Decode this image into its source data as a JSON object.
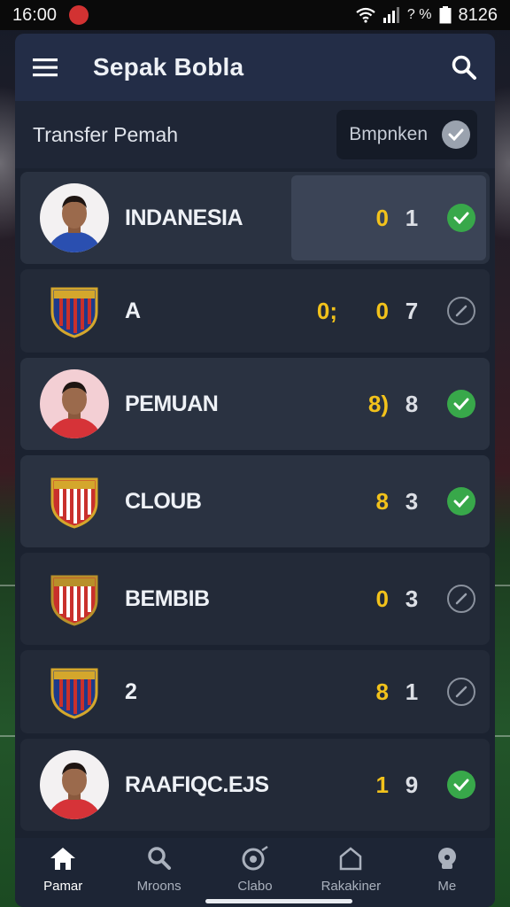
{
  "status_bar": {
    "time": "16:00",
    "battery_text": "? %",
    "right_text": "8126"
  },
  "header": {
    "title": "Sepak Bobla",
    "menu_icon": "menu-icon",
    "search_icon": "search-icon"
  },
  "filter": {
    "label": "Transfer Pemah",
    "chip_label": "Bmpnken",
    "checked": true
  },
  "rows": [
    {
      "name": "INDANESIA",
      "score_a": "0",
      "score_b": "1",
      "checked": true,
      "media": "player",
      "jersey": "#2a4fb0",
      "bg": "#f3f1f2"
    },
    {
      "name": "A",
      "score_pre": "0;",
      "score_a": "0",
      "score_b": "7",
      "checked": false,
      "media": "crest"
    },
    {
      "name": "PEMUAN",
      "score_a": "8)",
      "score_b": "8",
      "checked": true,
      "media": "player",
      "jersey": "#d63338",
      "bg": "#f3cfd4"
    },
    {
      "name": "CLOUB",
      "score_a": "8",
      "score_b": "3",
      "checked": true,
      "media": "crest"
    },
    {
      "name": "BEMBIB",
      "score_a": "0",
      "score_b": "3",
      "checked": false,
      "media": "crest"
    },
    {
      "name": "2",
      "score_a": "8",
      "score_b": "1",
      "checked": false,
      "media": "crest"
    },
    {
      "name": "RAAFIQC.EJS",
      "score_a": "1",
      "score_b": "9",
      "checked": true,
      "media": "player",
      "jersey": "#d63338",
      "bg": "#f3f1f2"
    }
  ],
  "bottom_nav": [
    {
      "label": "Pamar",
      "icon": "home-icon",
      "active": true
    },
    {
      "label": "Mroons",
      "icon": "search-icon",
      "active": false
    },
    {
      "label": "Clabo",
      "icon": "ball-icon",
      "active": false
    },
    {
      "label": "Rakakiner",
      "icon": "house-outline-icon",
      "active": false
    },
    {
      "label": "Me",
      "icon": "profile-icon",
      "active": false
    }
  ],
  "colors": {
    "accent_green": "#38a84a",
    "score_yellow": "#f2c21b",
    "appbar": "#232d47"
  }
}
